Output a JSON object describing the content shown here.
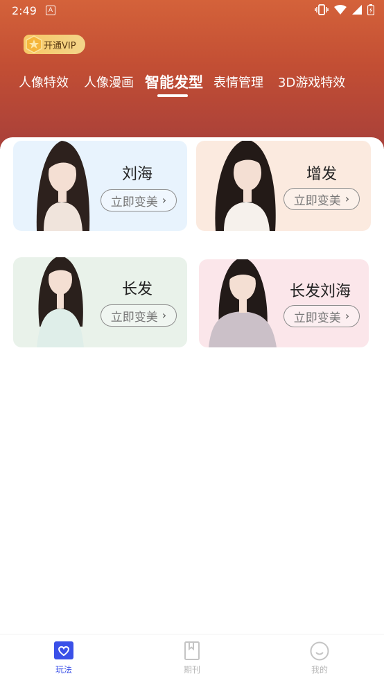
{
  "status": {
    "time": "2:49",
    "notification": "A"
  },
  "vip": {
    "label": "开通VIP"
  },
  "tabs": [
    {
      "label": "人像特效",
      "active": false
    },
    {
      "label": "人像漫画",
      "active": false
    },
    {
      "label": "智能发型",
      "active": true
    },
    {
      "label": "表情管理",
      "active": false
    },
    {
      "label": "3D游戏特效",
      "active": false
    }
  ],
  "cards": [
    {
      "title": "刘海",
      "button": "立即变美",
      "bg": "#e8f3fd"
    },
    {
      "title": "增发",
      "button": "立即变美",
      "bg": "#fbeadf"
    },
    {
      "title": "长发",
      "button": "立即变美",
      "bg": "#e9f2ea"
    },
    {
      "title": "长发刘海",
      "button": "立即变美",
      "bg": "#fbe6ea"
    }
  ],
  "nav": [
    {
      "label": "玩法",
      "icon": "heart-icon",
      "active": true
    },
    {
      "label": "期刊",
      "icon": "bookmark-icon",
      "active": false
    },
    {
      "label": "我的",
      "icon": "smile-icon",
      "active": false
    }
  ],
  "colors": {
    "accent": "#3a50e8",
    "header": "#c24e34",
    "nav_inactive": "#b8b8b8"
  }
}
